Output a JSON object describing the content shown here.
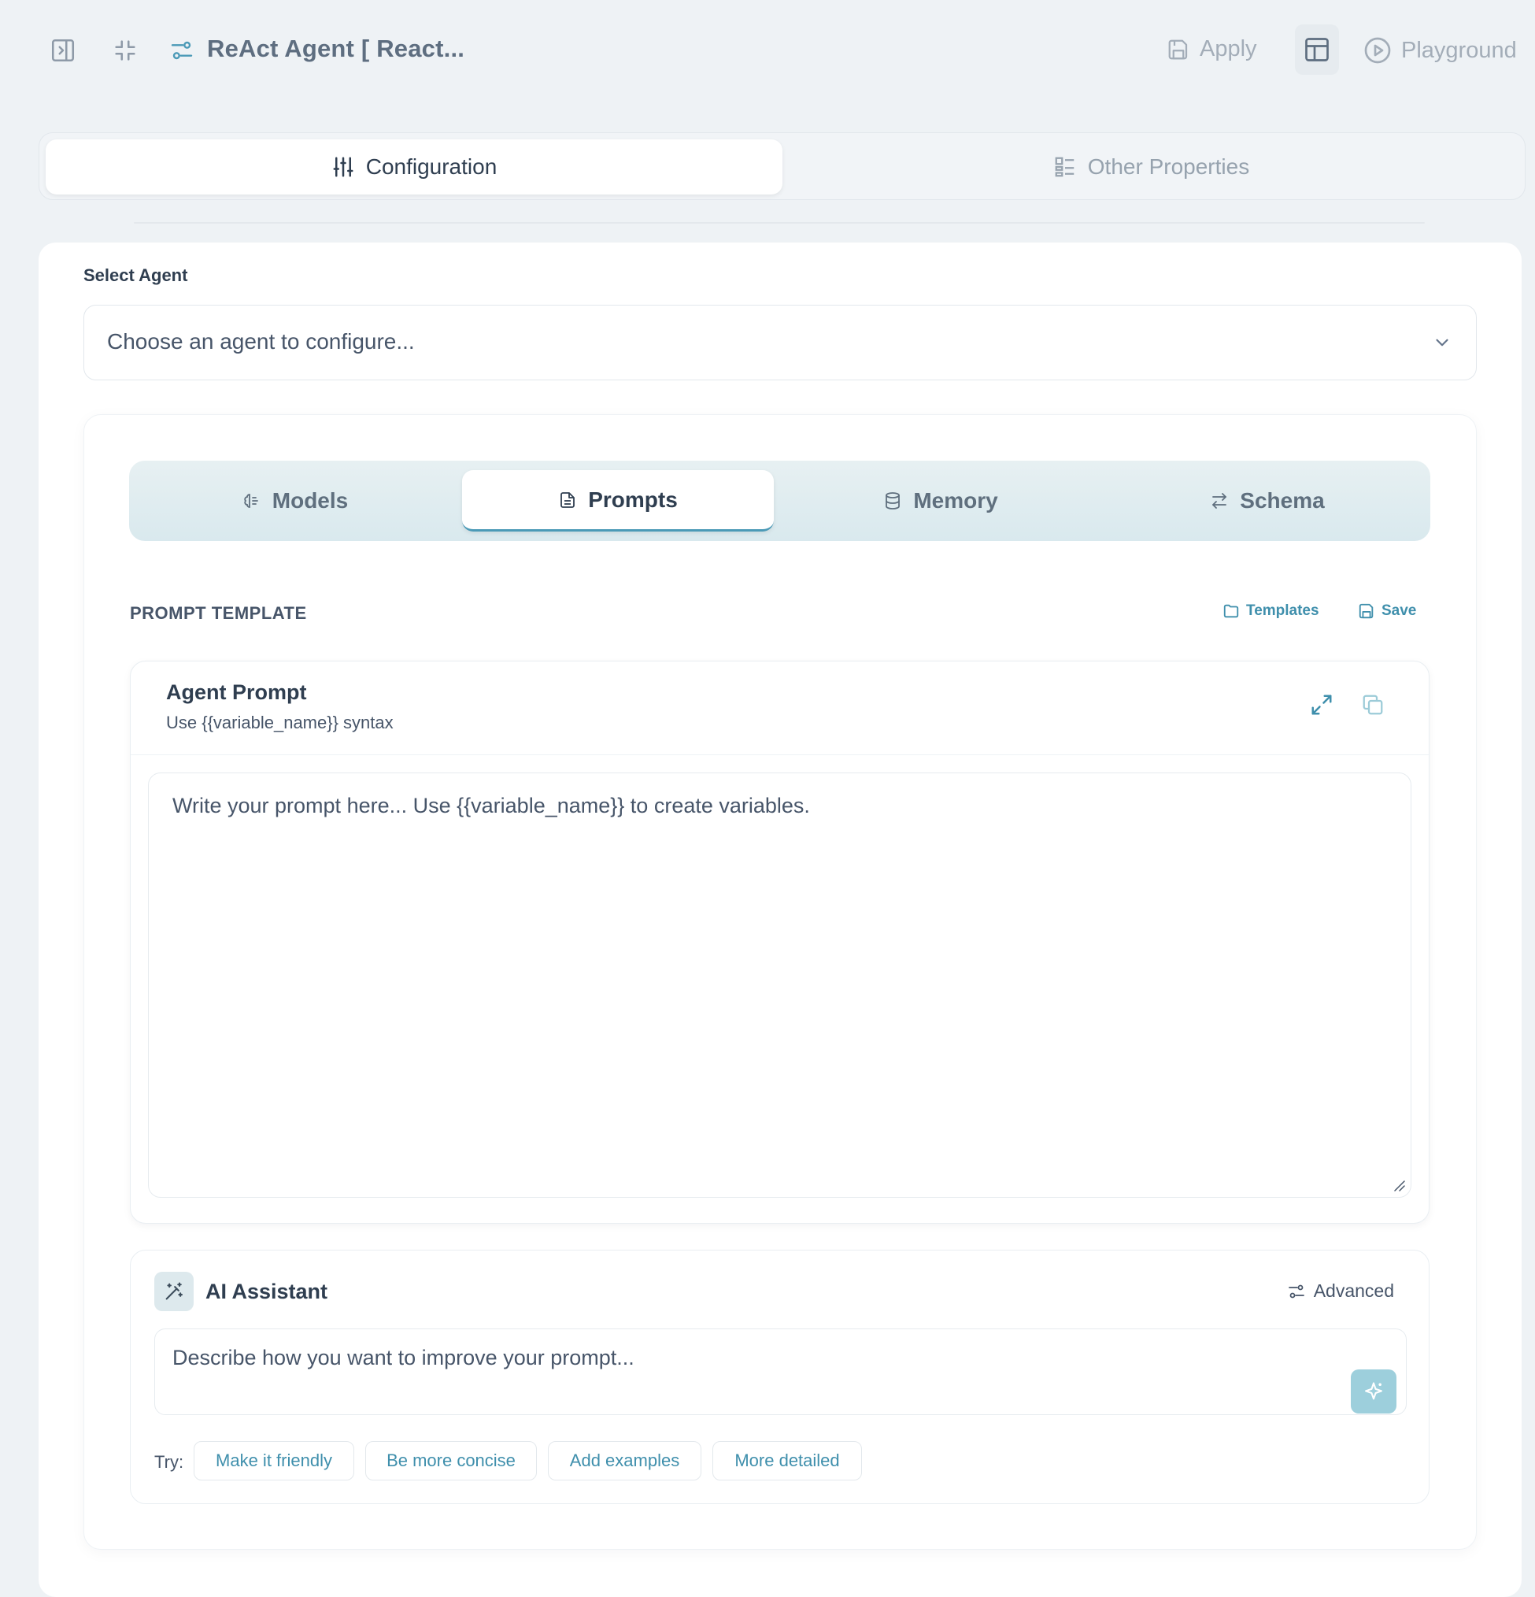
{
  "header": {
    "title": "ReAct Agent [ React...",
    "apply_label": "Apply",
    "playground_label": "Playground"
  },
  "top_tabs": [
    {
      "label": "Configuration",
      "active": true
    },
    {
      "label": "Other Properties",
      "active": false
    }
  ],
  "agent_select": {
    "label": "Select Agent",
    "placeholder": "Choose an agent to configure..."
  },
  "sub_tabs": [
    {
      "label": "Models",
      "icon": "brain-icon",
      "active": false
    },
    {
      "label": "Prompts",
      "icon": "document-icon",
      "active": true
    },
    {
      "label": "Memory",
      "icon": "database-icon",
      "active": false
    },
    {
      "label": "Schema",
      "icon": "swap-arrows-icon",
      "active": false
    }
  ],
  "prompt_section": {
    "title": "PROMPT TEMPLATE",
    "templates_label": "Templates",
    "save_label": "Save"
  },
  "prompt_editor": {
    "title": "Agent Prompt",
    "subtitle": "Use {{variable_name}} syntax",
    "placeholder": "Write your prompt here... Use {{variable_name}} to create variables.",
    "value": ""
  },
  "ai_assistant": {
    "title": "AI Assistant",
    "advanced_label": "Advanced",
    "placeholder": "Describe how you want to improve your prompt...",
    "try_label": "Try:",
    "suggestions": [
      "Make it friendly",
      "Be more concise",
      "Add examples",
      "More detailed"
    ]
  },
  "colors": {
    "accent": "#3f8fac",
    "tab_track": "#d9e9ee",
    "send_button": "#9dcfdc",
    "background": "#eef2f5"
  }
}
